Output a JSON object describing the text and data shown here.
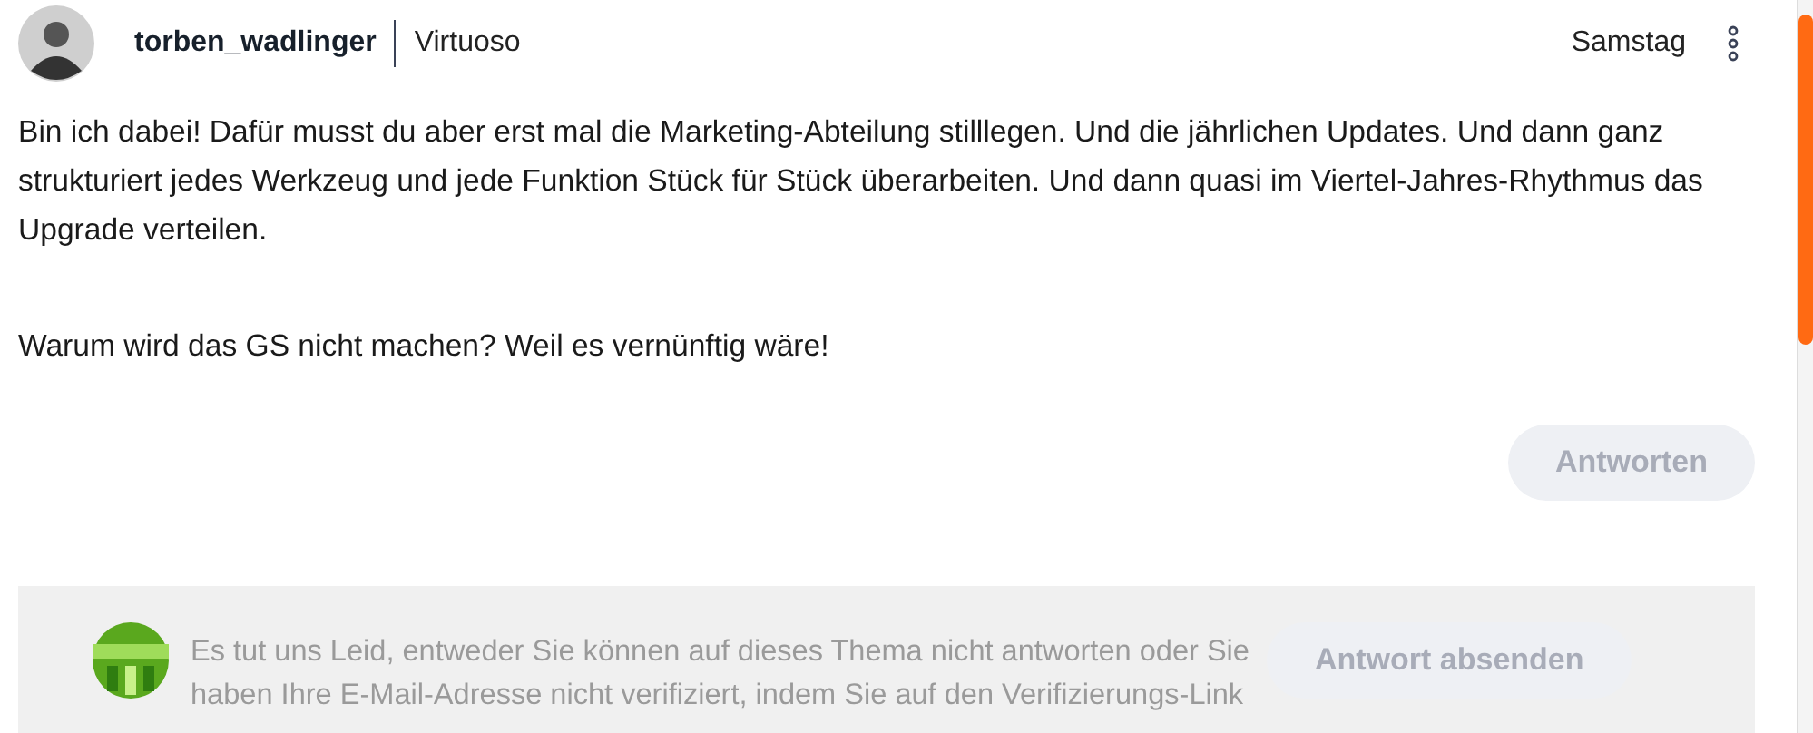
{
  "post": {
    "author": "torben_wadlinger",
    "rank": "Virtuoso",
    "date": "Samstag",
    "paragraphs": [
      "Bin ich dabei! Dafür musst du aber erst mal die Marketing-Abteilung stilllegen. Und die jährlichen Updates. Und dann ganz strukturiert jedes Werkzeug und jede Funktion Stück für Stück überarbeiten. Und dann quasi im Viertel-Jahres-Rhythmus das Upgrade verteilen.",
      "Warum wird das GS nicht machen? Weil es vernünftig wäre!"
    ],
    "reply_button": {
      "label": "Antworten",
      "disabled": true
    }
  },
  "composer": {
    "notice_lines": [
      "Es tut uns Leid, entweder Sie können auf dieses Thema nicht antworten oder Sie",
      "haben Ihre E-Mail-Adresse nicht verifiziert, indem Sie auf den Verifizierungs-Link"
    ],
    "send_button": {
      "label": "Antwort absenden",
      "disabled": true
    }
  }
}
